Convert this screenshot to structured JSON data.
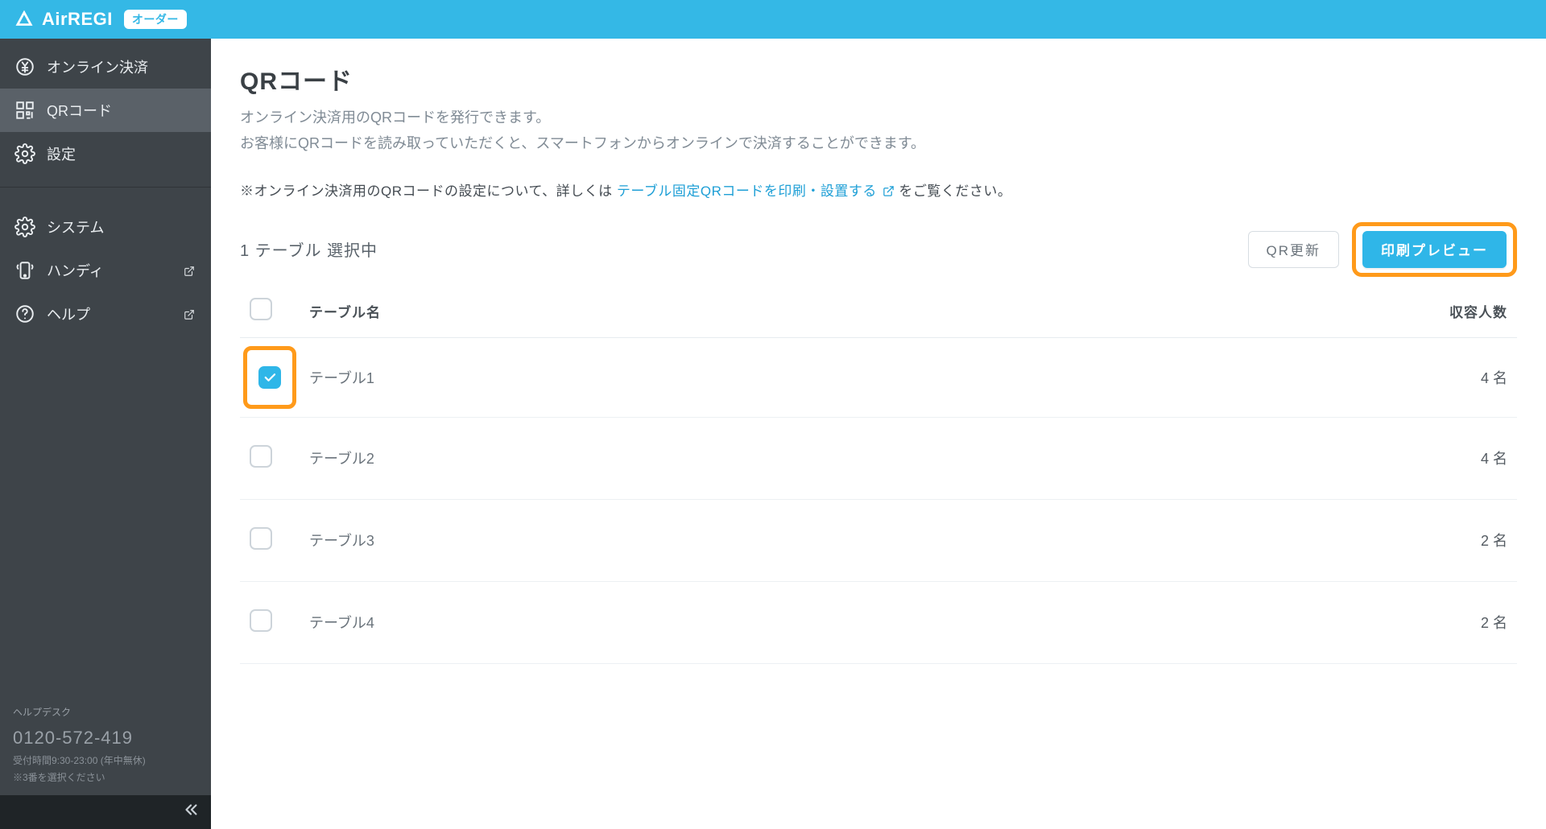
{
  "header": {
    "brand": "AirREGI",
    "order_badge": "オーダー"
  },
  "sidebar": {
    "items_top": [
      {
        "id": "online-payment",
        "label": "オンライン決済",
        "icon": "yen-orb-icon",
        "active": false
      },
      {
        "id": "qr-code",
        "label": "QRコード",
        "icon": "qr-icon",
        "active": true
      },
      {
        "id": "settings",
        "label": "設定",
        "icon": "gear-icon",
        "active": false
      }
    ],
    "items_bottom": [
      {
        "id": "system",
        "label": "システム",
        "icon": "gear-icon",
        "external": false
      },
      {
        "id": "handy",
        "label": "ハンディ",
        "icon": "device-icon",
        "external": true
      },
      {
        "id": "help",
        "label": "ヘルプ",
        "icon": "help-icon",
        "external": true
      }
    ],
    "helpdesk": {
      "title": "ヘルプデスク",
      "phone": "0120-572-419",
      "hours": "受付時間9:30-23:00 (年中無休)",
      "note": "※3番を選択ください"
    }
  },
  "page": {
    "title": "QRコード",
    "description_line1": "オンライン決済用のQRコードを発行できます。",
    "description_line2": "お客様にQRコードを読み取っていただくと、スマートフォンからオンラインで決済することができます。",
    "note_prefix": "※オンライン決済用のQRコードの設定について、詳しくは",
    "note_link": "テーブル固定QRコードを印刷・設置する",
    "note_suffix": "をご覧ください。",
    "selection_count_text": "1 テーブル 選択中",
    "buttons": {
      "qr_refresh": "QR更新",
      "print_preview": "印刷プレビュー"
    },
    "table": {
      "headers": {
        "name": "テーブル名",
        "capacity": "収容人数"
      },
      "capacity_unit": "名",
      "rows": [
        {
          "checked": true,
          "name": "テーブル1",
          "capacity": 4,
          "highlight": true
        },
        {
          "checked": false,
          "name": "テーブル2",
          "capacity": 4,
          "highlight": false
        },
        {
          "checked": false,
          "name": "テーブル3",
          "capacity": 2,
          "highlight": false
        },
        {
          "checked": false,
          "name": "テーブル4",
          "capacity": 2,
          "highlight": false
        }
      ]
    }
  }
}
